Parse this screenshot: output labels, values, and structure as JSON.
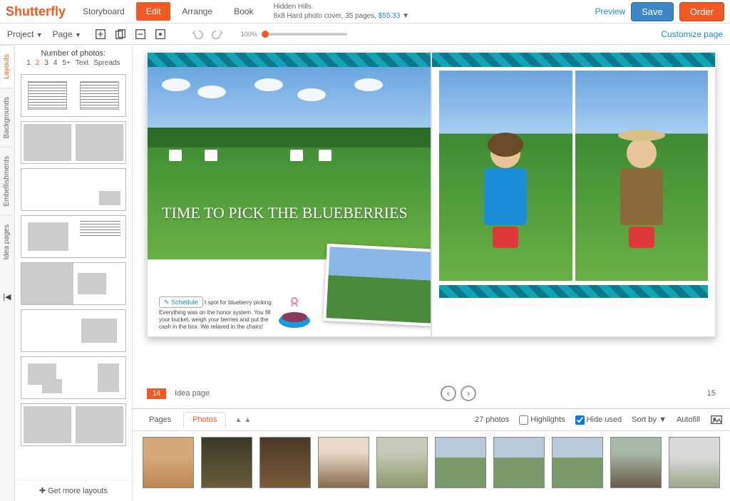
{
  "logo": "Shutterfly",
  "top_tabs": {
    "storyboard": "Storyboard",
    "edit": "Edit",
    "arrange": "Arrange",
    "book": "Book"
  },
  "book_info": {
    "title": "Hidden Hills",
    "spec": "8x8 Hard photo cover, 35 pages, ",
    "price": "$55.33"
  },
  "top_right": {
    "preview": "Preview",
    "save": "Save",
    "order": "Order"
  },
  "toolbar": {
    "project": "Project",
    "page": "Page",
    "zoom": "100%",
    "customize": "Customize page"
  },
  "side_tabs": {
    "layouts": "Layouts",
    "backgrounds": "Backgrounds",
    "embellishments": "Embellishments",
    "idea_pages": "Idea pages"
  },
  "layouts": {
    "head": "Number of photos:",
    "filters": [
      "1",
      "2",
      "3",
      "4",
      "5+",
      "Text",
      "Spreads"
    ],
    "more": "Get more layouts"
  },
  "book": {
    "title": "TIME TO PICK THE BLUEBERRIES",
    "schedule": "Schedule",
    "caption": "t spot for blueberry picking. Everything was on the honor system. You fill your bucket, weigh your berries and put the cash in the box. We relaxed in the chairs!",
    "page_left": "14",
    "idea": "Idea page",
    "page_right": "15"
  },
  "bottom": {
    "pages": "Pages",
    "photos": "Photos",
    "count": "27 photos",
    "highlights": "Highlights",
    "hide": "Hide used",
    "sort": "Sort by",
    "autofill": "Autofill"
  }
}
